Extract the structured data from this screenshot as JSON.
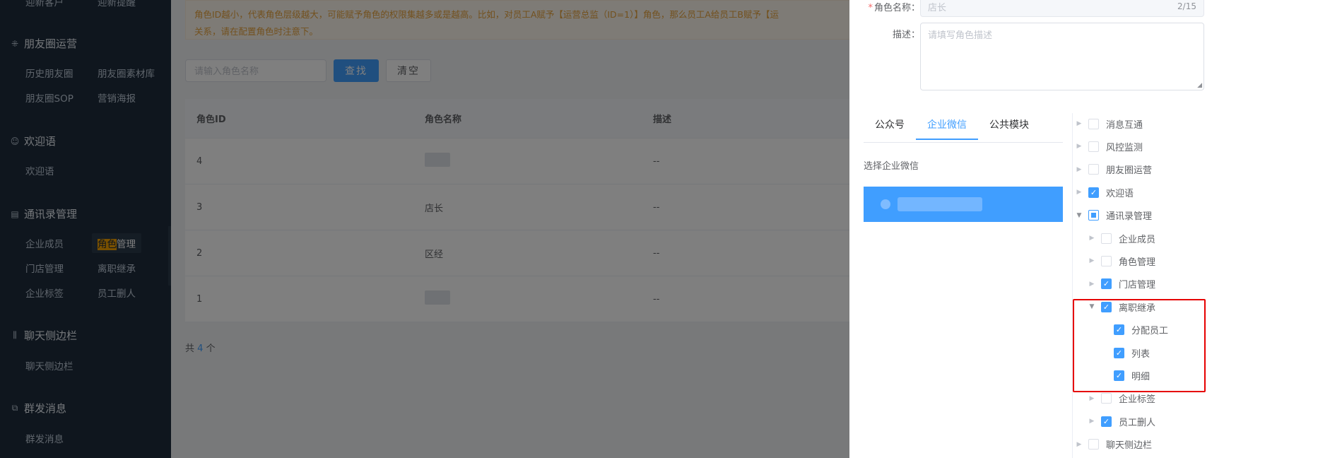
{
  "sidebar": {
    "top_items": [
      "迎新客户",
      "迎新提醒"
    ],
    "groups": [
      {
        "icon": "grid-icon",
        "title": "朋友圈运营",
        "items": [
          "历史朋友圈",
          "朋友圈素材库",
          "朋友圈SOP",
          "营销海报"
        ]
      },
      {
        "icon": "smile-icon",
        "title": "欢迎语",
        "items": [
          "欢迎语"
        ]
      },
      {
        "icon": "contacts-icon",
        "title": "通讯录管理",
        "items": [
          "企业成员",
          "角色管理",
          "门店管理",
          "离职继承",
          "企业标签",
          "员工删人"
        ]
      },
      {
        "icon": "sliders-icon",
        "title": "聊天侧边栏",
        "items": [
          "聊天侧边栏"
        ]
      },
      {
        "icon": "message-icon",
        "title": "群发消息",
        "items": [
          "群发消息"
        ]
      }
    ],
    "active_item_highlight": "角色",
    "active_item_rest": "管理",
    "collapse_glyph": "‹"
  },
  "main": {
    "warning_line1": "角色ID越小，代表角色层级越大，可能赋予角色的权限集越多或是越高。比如，对员工A赋予【运营总监（ID=1）】角色，那么员工A给员工B赋予【运",
    "warning_line2": "关系，请在配置角色时注意下。",
    "search_placeholder": "请输入角色名称",
    "search_button": "查找",
    "clear_button": "清空",
    "table": {
      "headers": [
        "角色ID",
        "角色名称",
        "描述"
      ],
      "rows": [
        {
          "id": "4",
          "name": "",
          "desc": "--"
        },
        {
          "id": "3",
          "name": "店长",
          "desc": "--"
        },
        {
          "id": "2",
          "name": "区经",
          "desc": "--"
        },
        {
          "id": "1",
          "name": "",
          "desc": "--"
        }
      ]
    },
    "total_prefix": "共",
    "total_count": "4",
    "total_suffix": "个"
  },
  "drawer": {
    "role_name_label": "角色名称：",
    "role_name_required": "*",
    "role_name_value": "店长",
    "role_name_count": "2/15",
    "desc_label": "描述：",
    "desc_placeholder": "请填写角色描述",
    "tabs": [
      "公众号",
      "企业微信",
      "公共模块"
    ],
    "active_tab": "企业微信",
    "choose_label": "选择企业微信",
    "tree": [
      {
        "label": "消息互通",
        "level": 0,
        "state": "unchecked",
        "arrow": "collapsed"
      },
      {
        "label": "风控监测",
        "level": 0,
        "state": "unchecked",
        "arrow": "collapsed"
      },
      {
        "label": "朋友圈运营",
        "level": 0,
        "state": "unchecked",
        "arrow": "collapsed"
      },
      {
        "label": "欢迎语",
        "level": 0,
        "state": "checked",
        "arrow": "collapsed"
      },
      {
        "label": "通讯录管理",
        "level": 0,
        "state": "indeterminate",
        "arrow": "expanded"
      },
      {
        "label": "企业成员",
        "level": 1,
        "state": "unchecked",
        "arrow": "collapsed"
      },
      {
        "label": "角色管理",
        "level": 1,
        "state": "unchecked",
        "arrow": "collapsed"
      },
      {
        "label": "门店管理",
        "level": 1,
        "state": "checked",
        "arrow": "collapsed"
      },
      {
        "label": "离职继承",
        "level": 1,
        "state": "checked",
        "arrow": "expanded"
      },
      {
        "label": "分配员工",
        "level": 2,
        "state": "checked",
        "arrow": "none"
      },
      {
        "label": "列表",
        "level": 2,
        "state": "checked",
        "arrow": "none"
      },
      {
        "label": "明细",
        "level": 2,
        "state": "checked",
        "arrow": "none"
      },
      {
        "label": "企业标签",
        "level": 1,
        "state": "unchecked",
        "arrow": "collapsed"
      },
      {
        "label": "员工删人",
        "level": 1,
        "state": "checked",
        "arrow": "collapsed"
      },
      {
        "label": "聊天侧边栏",
        "level": 0,
        "state": "unchecked",
        "arrow": "collapsed"
      }
    ]
  },
  "colors": {
    "primary": "#409eff",
    "sidebar_bg": "#1f2d3d",
    "warning_text": "#e6a23c",
    "highlight_border": "#e60000"
  }
}
